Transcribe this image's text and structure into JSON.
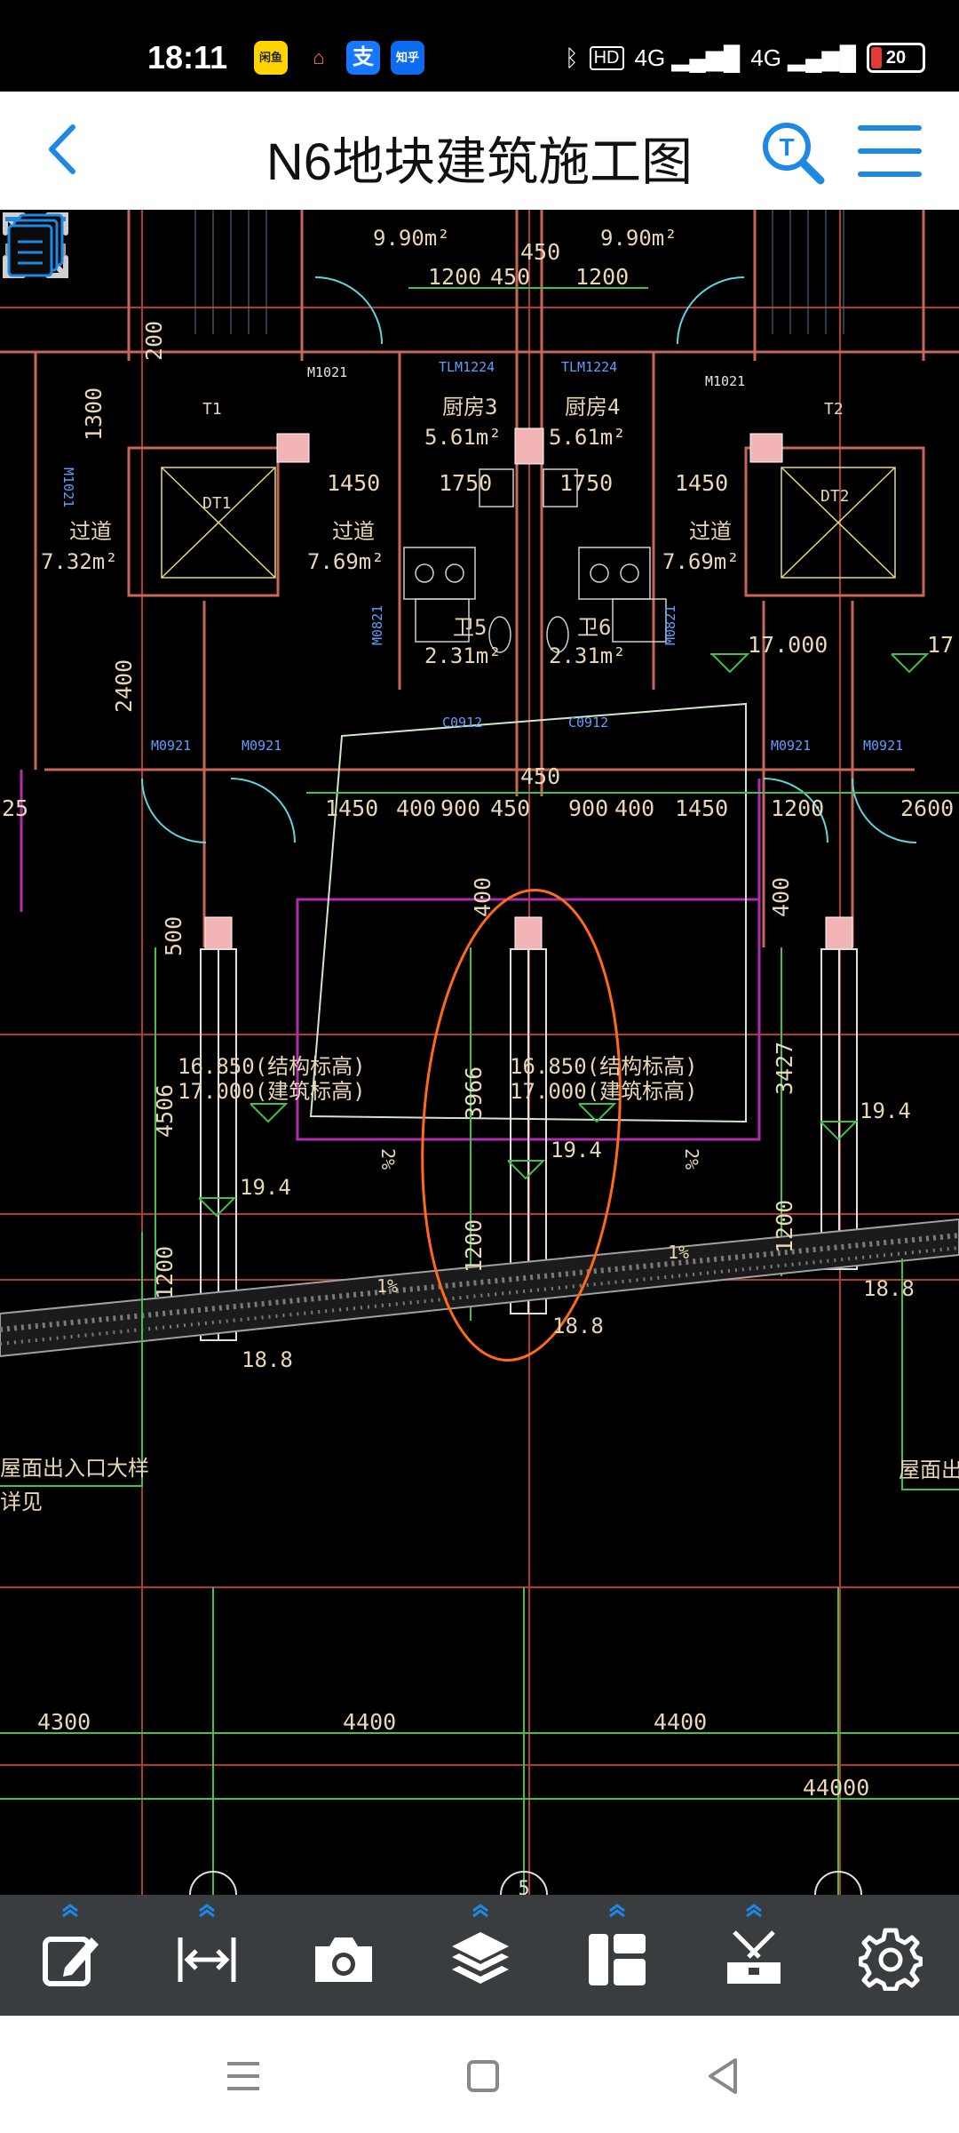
{
  "status_bar": {
    "time": "18:11",
    "apps": [
      "闲鱼",
      "home",
      "支",
      "知乎"
    ],
    "network": "4G",
    "battery": "20"
  },
  "header": {
    "title": "N6地块建筑施工图"
  },
  "drawing": {
    "rooms": {
      "keting_left": "9.90m²",
      "keting_right": "9.90m²",
      "chufang3": "厨房3",
      "chufang3_area": "5.61m²",
      "chufang4": "厨房4",
      "chufang4_area": "5.61m²",
      "guodao": "过道",
      "guodao_left_area": "7.32m²",
      "guodao_mid_area": "7.69m²",
      "guodao_right_area": "7.69m²",
      "wei5": "卫5",
      "wei5_area": "2.31m²",
      "wei6": "卫6",
      "wei6_area": "2.31m²",
      "dt1": "DT1",
      "dt2": "DT2",
      "t1": "T1",
      "t2": "T2"
    },
    "doors": {
      "m1021_left": "M1021",
      "m1021_right": "M1021",
      "tlm1224_left": "TLM1224",
      "tlm1224_right": "TLM1224",
      "m0821_left": "M0821",
      "m0821_right": "M0821",
      "m1021_vert": "M1021",
      "c0912_left": "C0912",
      "c0912_right": "C0912",
      "m0921_1": "M0921",
      "m0921_2": "M0921",
      "m0921_3": "M0921",
      "m0921_4": "M0921"
    },
    "dims": {
      "d450_top": "450",
      "d1200_a": "1200",
      "d450_b": "450",
      "d1200_c": "1200",
      "d200": "200",
      "d1300": "1300",
      "d1450_a": "1450",
      "d1750_a": "1750",
      "d1750_b": "1750",
      "d1450_b": "1450",
      "d2400": "2400",
      "d450_mid": "450",
      "d25": "25",
      "row_1450_a": "1450",
      "row_400_a": "400",
      "row_900_a": "900",
      "row_450": "450",
      "row_900_b": "900",
      "row_400_b": "400",
      "row_1450_b": "1450",
      "row_1200": "1200",
      "row_2600": "2600",
      "v400_a": "400",
      "v400_b": "400",
      "v500": "500",
      "v4506": "4506",
      "v3966": "3966",
      "v3427": "3427",
      "v1200_a": "1200",
      "v1200_b": "1200",
      "v1200_c": "1200",
      "e17000_a": "17.000",
      "e17_b": "17.",
      "grid_4300": "4300",
      "grid_4400_a": "4400",
      "grid_4400_b": "4400",
      "grid_44000": "44000"
    },
    "elev": {
      "struct_left": "16.850(结构标高)",
      "arch_left": "17.000(建筑标高)",
      "struct_mid": "16.850(结构标高)",
      "arch_mid": "17.000(建筑标高)",
      "e194_left": "19.4",
      "e194_mid": "19.4",
      "e194_right": "19.4",
      "e188_left": "18.8",
      "e188_mid": "18.8",
      "e188_right": "18.8",
      "slope_a": "1%",
      "slope_b": "1%",
      "slope_v1": "2%",
      "slope_v2": "2%"
    },
    "notes": {
      "roof_exit": "屋面出入口大样",
      "see_detail": "详见",
      "roof_exit_right": "屋面出入"
    },
    "grid_bubble": "5"
  },
  "toolbar": {
    "tools": [
      "annotate",
      "measure",
      "camera",
      "layers",
      "layout",
      "tools",
      "settings"
    ]
  },
  "colors": {
    "cad_bg": "#000000",
    "wall": "#c9665a",
    "dim_green": "#3ec24a",
    "text_beige": "#e8d6b4",
    "door_blue": "#5aa0ff",
    "accent_blue": "#1e88e5",
    "markup_orange": "#ff6a1a",
    "toolbar_bg": "#3a3d40"
  }
}
